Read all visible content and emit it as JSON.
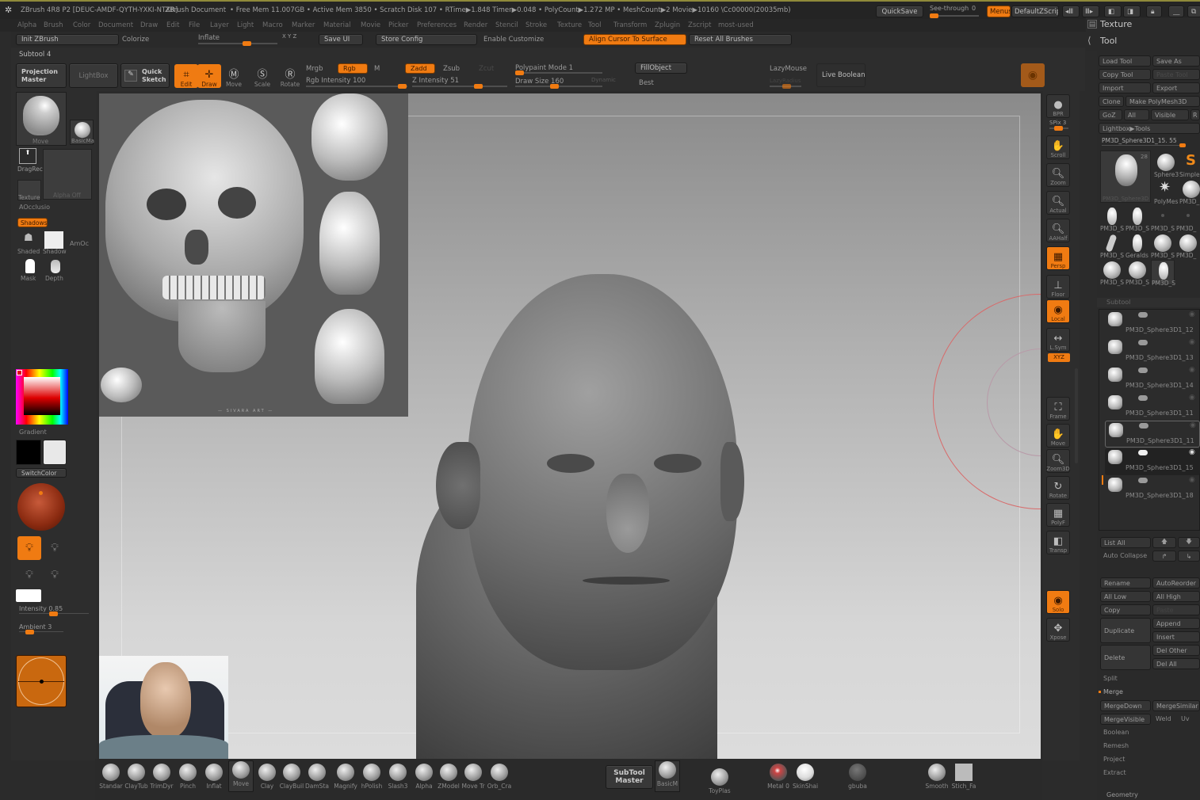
{
  "titlebar": {
    "app_title": "ZBrush 4R8 P2 [DEUC-AMDF-QYTH-YXKI-NTXR]",
    "document": "ZBrush Document",
    "stats": "• Free Mem 11.007GB • Active Mem 3850 • Scratch Disk 107 • RTime▶1.848 Timer▶0.048 • PolyCount▶1.272 MP • MeshCount▶2  Movie▶10160 \\Cc00000(20035mb)",
    "quicksave": "QuickSave",
    "see_through_label": "See-through",
    "see_through_value": "0",
    "see_through_fraction": 0.05,
    "menus": "Menus",
    "default_zscript": "DefaultZScript"
  },
  "menubar": [
    "Alpha",
    "Brush",
    "Color",
    "Document",
    "Draw",
    "Edit",
    "File",
    "Layer",
    "Light",
    "Macro",
    "Marker",
    "Material",
    "Movie",
    "Picker",
    "Preferences",
    "Render",
    "Stencil",
    "Stroke",
    "Texture",
    "Tool",
    "Transform",
    "Zplugin",
    "Zscript",
    "most-used"
  ],
  "customrow": {
    "init": "Init ZBrush",
    "colorize": "Colorize",
    "inflate": "Inflate",
    "inflate_fraction": 0.55,
    "xyz": "X Y Z",
    "save_ui": "Save UI",
    "store_config": "Store Config",
    "enable_customize": "Enable Customize",
    "align_cursor": "Align Cursor To Surface",
    "reset_brushes": "Reset All Brushes"
  },
  "palette_headers": {
    "texture": "Texture",
    "tool": "Tool"
  },
  "toolbar": {
    "subtool_label": "Subtool 4",
    "projection_master": "Projection Master",
    "lightbox": "LightBox",
    "quick_sketch": "Quick Sketch",
    "edit": "Edit",
    "draw": "Draw",
    "move": "Move",
    "scale": "Scale",
    "rotate": "Rotate",
    "mrgb": "Mrgb",
    "rgb": "Rgb",
    "m": "M",
    "rgb_intensity_label": "Rgb Intensity 100",
    "rgb_intensity": 100,
    "zadd": "Zadd",
    "zsub": "Zsub",
    "zcut": "Zcut",
    "z_intensity_label": "Z Intensity 51",
    "z_intensity": 51,
    "polypaint_mode": "Polypaint Mode 1",
    "draw_size_label": "Draw Size 160",
    "draw_size": 160,
    "dynamic": "Dynamic",
    "fill_object": "FillObject",
    "best": "Best",
    "lazymouse": "LazyMouse",
    "lazyradius": "LazyRadius",
    "live_boolean": "Live Boolean"
  },
  "leftbar": {
    "brush_name": "Move",
    "material_name": "BasicMa",
    "stroke": "DragRect",
    "alpha": "Alpha Off",
    "texture": "Texture",
    "aocclusion": "AOcclusio",
    "shadows": "Shadows",
    "shaded": "Shaded",
    "shadow": "Shadow",
    "amoc": "AmOc",
    "mask": "Mask",
    "depth": "Depth",
    "gradient": "Gradient",
    "switch_color": "SwitchColor",
    "intensity_label": "Intensity 0.85",
    "intensity": 0.85,
    "ambient_label": "Ambient 3",
    "ambient": 3,
    "main_color": "#e3001b",
    "secondary_color": "#e8e8e8",
    "primary_swatch": "#000000"
  },
  "rightshelf": [
    "BPR",
    "SPix 3",
    "Scroll",
    "Zoom",
    "Actual",
    "AAHalf",
    "Persp",
    "Floor",
    "Local",
    "L.Sym",
    "XYZ",
    "Frame",
    "Move",
    "Zoom3D",
    "Rotate",
    "PolyF",
    "Transp",
    "Solo",
    "Xpose"
  ],
  "tool_palette": {
    "load_tool": "Load Tool",
    "save_as": "Save As",
    "copy_tool": "Copy Tool",
    "paste_tool": "Paste Tool",
    "import": "Import",
    "export": "Export",
    "clone": "Clone",
    "make_polymesh": "Make PolyMesh3D",
    "goz": "GoZ",
    "all": "All",
    "visible": "Visible",
    "r": "R",
    "lightbox_tools": "Lightbox▶Tools",
    "current_tool": "PM3D_Sphere3D1_15. 55",
    "current_tool_count": "28",
    "thumbs": [
      {
        "label": "Sphere3"
      },
      {
        "label": "Simple"
      },
      {
        "label": "PolyMes"
      },
      {
        "label": "PM3D_"
      },
      {
        "label": "PM3D_S"
      },
      {
        "label": "PM3D_S"
      },
      {
        "label": "PM3D_S"
      },
      {
        "label": "PM3D_"
      },
      {
        "label": "PM3D_S"
      },
      {
        "label": "Geralds"
      },
      {
        "label": "PM3D_S"
      },
      {
        "label": "PM3D_"
      },
      {
        "label": "PM3D_S"
      },
      {
        "label": "PM3D_S"
      },
      {
        "label": "PM3D_S"
      }
    ],
    "main_thumb_label": "PM3D_Sphere3D"
  },
  "subtool": {
    "header": "Subtool",
    "items": [
      {
        "name": "PM3D_Sphere3D1_12",
        "selected": false
      },
      {
        "name": "PM3D_Sphere3D1_13",
        "selected": false
      },
      {
        "name": "PM3D_Sphere3D1_14",
        "selected": false
      },
      {
        "name": "PM3D_Sphere3D1_11",
        "selected": false
      },
      {
        "name": "PM3D_Sphere3D1_11",
        "selected": false
      },
      {
        "name": "PM3D_Sphere3D1_15",
        "selected": true
      },
      {
        "name": "PM3D_Sphere3D1_18",
        "selected": false
      }
    ],
    "list_all": "List All",
    "auto_collapse": "Auto Collapse",
    "rename": "Rename",
    "auto_reorder": "AutoReorder",
    "all_low": "All Low",
    "all_high": "All High",
    "copy": "Copy",
    "paste": "Paste",
    "duplicate": "Duplicate",
    "append": "Append",
    "insert": "Insert",
    "delete": "Delete",
    "del_other": "Del Other",
    "del_all": "Del All",
    "split": "Split",
    "merge": "Merge",
    "merge_down": "MergeDown",
    "merge_similar": "MergeSimilar",
    "merge_visible": "MergeVisible",
    "weld": "Weld",
    "uv": "Uv",
    "boolean": "Boolean",
    "remesh": "Remesh",
    "project": "Project",
    "extract": "Extract",
    "geometry": "Geometry"
  },
  "bottombar": {
    "brushes": [
      "Standar",
      "ClayTub",
      "TrimDyr",
      "Pinch",
      "Inflat",
      "Move",
      "Clay",
      "ClayBuil",
      "DamSta",
      "Magnify",
      "hPolish",
      "Slash3",
      "Alpha",
      "ZModel",
      "Move Tr",
      "Orb_Cra"
    ],
    "subtool_master": "SubTool Master",
    "materials": [
      "BasicM",
      "ToyPlas",
      "Metal 0",
      "SkinShai",
      "gbuba",
      "Smooth",
      "Stich_Fa"
    ]
  },
  "viewport": {
    "reference_caption": "— SIVARA ART —",
    "accent_color": "#f07b12"
  }
}
